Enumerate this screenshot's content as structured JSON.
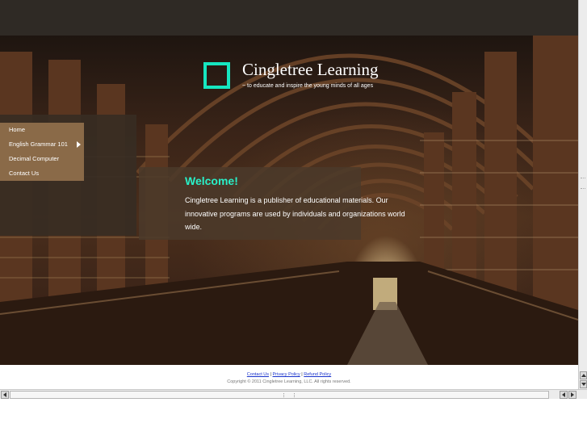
{
  "site": {
    "title": "Cingletree Learning",
    "tagline": "~ to educate and inspire the young minds of all ages",
    "logo_color": "#16e6c0"
  },
  "nav": {
    "items": [
      {
        "label": "Home",
        "has_submenu": false
      },
      {
        "label": "English Grammar 101",
        "has_submenu": true
      },
      {
        "label": "Decimal Computer",
        "has_submenu": false
      },
      {
        "label": "Contact Us",
        "has_submenu": false
      }
    ]
  },
  "welcome": {
    "title": "Welcome!",
    "body": "Cingletree Learning is a publisher of educational materials. Our innovative programs are used by individuals and organizations world wide."
  },
  "footer": {
    "links": [
      "Contact Us",
      "Privacy Policy",
      "Refund Policy"
    ],
    "separator": "|",
    "copyright": "Copyright © 2011 Cingletree Learning, LLC. All rights reserved."
  },
  "colors": {
    "accent": "#29f0c8",
    "nav_bg": "#8a6a48",
    "top_bar": "#2f2a25"
  },
  "icons": {
    "logo": "square-outline-logo",
    "submenu": "triangle-right-icon"
  }
}
